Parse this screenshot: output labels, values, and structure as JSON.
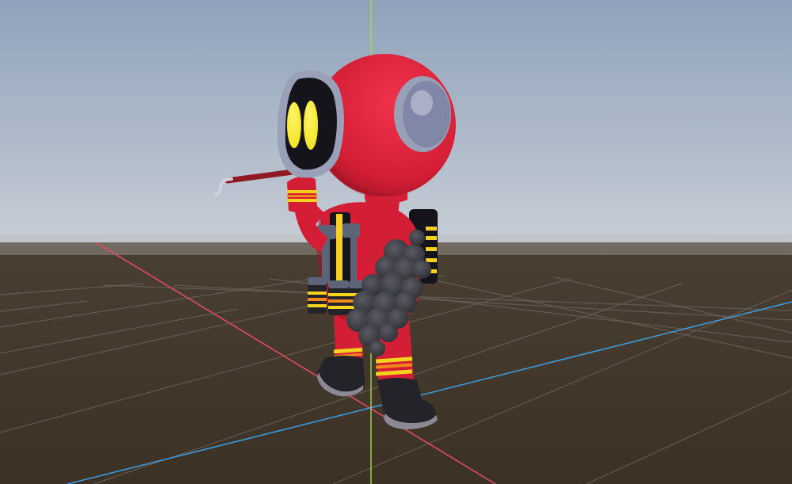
{
  "viewport": {
    "kind": "3d-scene-viewport",
    "colors": {
      "sky_top": "#8fa2bb",
      "sky_horizon": "#c9cfd6",
      "ground_near": "#3c3125",
      "ground_far": "#4a3f33",
      "grid_line": "#6f665c",
      "axis_x": "#e04b5f",
      "axis_y": "#a9d84a",
      "axis_z": "#3c9bde"
    },
    "grid": true,
    "axes": [
      "x",
      "y",
      "z"
    ]
  },
  "character": {
    "kind": "firefighter-robot",
    "colors": {
      "body_red": "#d41e35",
      "dark_red": "#9e1424",
      "visor_black": "#15141a",
      "visor_rim": "#9aa0b8",
      "eye_yellow": "#f2e21c",
      "stripe_yellow": "#f5d21e",
      "stripe_orange": "#f08a1c",
      "strap_gray": "#5c6578",
      "boot_black": "#24232a",
      "smoke": "#2f3036",
      "tool_red": "#8f1a24",
      "tool_metal": "#cfd2dc"
    },
    "props": [
      "crowbar",
      "backpack-tank",
      "smoke-cloud",
      "belt-canisters"
    ]
  }
}
